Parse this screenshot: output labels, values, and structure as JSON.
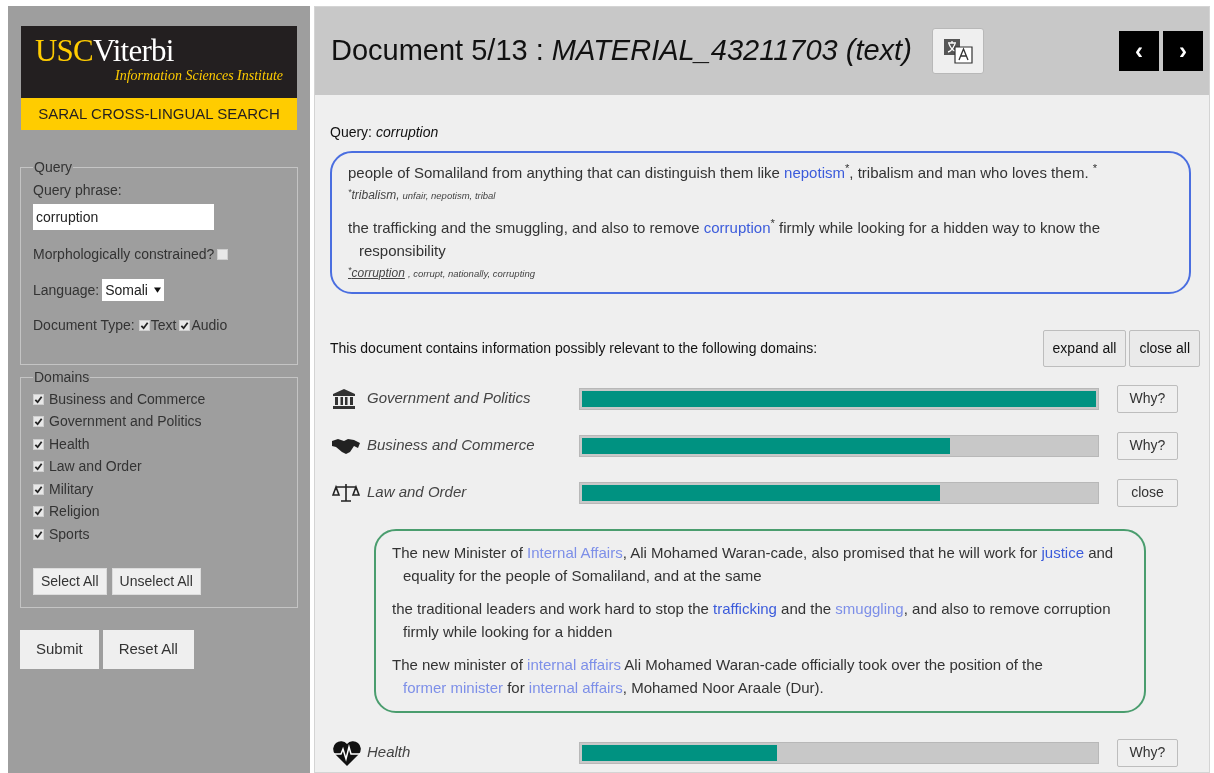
{
  "sidebar": {
    "logo": {
      "brand": "USC",
      "name": "Viterbi",
      "subtitle": "Information Sciences Institute"
    },
    "app_title": "SARAL CROSS-LINGUAL SEARCH",
    "query": {
      "legend": "Query",
      "phrase_label": "Query phrase:",
      "phrase_value": "corruption",
      "morph_label": "Morphologically constrained?",
      "morph_checked": false,
      "language_label": "Language:",
      "language_value": "Somali",
      "doc_type_label": "Document Type:",
      "doc_types": [
        {
          "label": "Text",
          "checked": true
        },
        {
          "label": "Audio",
          "checked": true
        }
      ]
    },
    "domains": {
      "legend": "Domains",
      "items": [
        {
          "label": "Business and Commerce",
          "checked": true
        },
        {
          "label": "Government and Politics",
          "checked": true
        },
        {
          "label": "Health",
          "checked": true
        },
        {
          "label": "Law and Order",
          "checked": true
        },
        {
          "label": "Military",
          "checked": true
        },
        {
          "label": "Religion",
          "checked": true
        },
        {
          "label": "Sports",
          "checked": true
        }
      ],
      "buttons": [
        "Select All",
        "Unselect All"
      ]
    },
    "buttons": [
      "Submit",
      "Reset All"
    ]
  },
  "header": {
    "title": "Document 5/13 :",
    "document": "MATERIAL_43211703 (text)",
    "nav": [
      "‹",
      "›"
    ]
  },
  "query_label": "Query:",
  "query_term": "corruption",
  "query_matches": [
    {
      "segments": [
        {
          "text": "people of Somaliland from anything that can distinguish them like ",
          "kind": "plain"
        },
        {
          "text": "nepotism",
          "kind": "strong"
        },
        {
          "text": "$^{*}$, tribalism and man who loves them. $^{*}$",
          "kind": "plain"
        }
      ],
      "footnote": [
        {
          "text": "$^{*}$tribalism,",
          "primary": true,
          "underlined": false
        },
        {
          "text": "unfair, nepotism, tribal",
          "primary": false,
          "underlined": false
        }
      ]
    },
    {
      "segments": [
        {
          "text": "the trafficking and the smuggling, and also to remove ",
          "kind": "plain"
        },
        {
          "text": "corruption",
          "kind": "strong"
        },
        {
          "text": "$^{*}$ firmly while looking for a hidden way to know the responsibility",
          "kind": "plain"
        }
      ],
      "footnote": [
        {
          "text": "$^{*}$corruption",
          "primary": true,
          "underlined": true
        },
        {
          "text": ", corrupt, nationally, corrupting",
          "primary": false,
          "underlined": false
        }
      ]
    }
  ],
  "domains_intro": "This document contains information possibly relevant to the following domains:",
  "domain_buttons": [
    "expand all",
    "close all"
  ],
  "domains": [
    {
      "kind": "government",
      "label": "Government and Politics",
      "level": 1.0,
      "button": "Why?"
    },
    {
      "kind": "business",
      "label": "Business and Commerce",
      "level": 0.715,
      "button": "Why?"
    },
    {
      "kind": "law",
      "label": "Law and Order",
      "level": 0.697,
      "button": "close",
      "snippets": [
        {
          "segments": [
            {
              "text": "The new Minister of ",
              "kind": "plain"
            },
            {
              "text": "Internal Affairs",
              "kind": "light"
            },
            {
              "text": ", Ali Mohamed Waran-cade, also promised that he will work for ",
              "kind": "plain"
            },
            {
              "text": "justice",
              "kind": "strong"
            },
            {
              "text": " and equality for the people of Somaliland, and at the same",
              "kind": "plain"
            }
          ]
        },
        {
          "segments": [
            {
              "text": "the traditional leaders and work hard to stop the ",
              "kind": "plain"
            },
            {
              "text": "trafficking",
              "kind": "strong"
            },
            {
              "text": " and the ",
              "kind": "plain"
            },
            {
              "text": "smuggling",
              "kind": "light"
            },
            {
              "text": ", and also to remove corruption firmly while looking for a hidden",
              "kind": "plain"
            }
          ]
        },
        {
          "segments": [
            {
              "text": "The new minister of ",
              "kind": "plain"
            },
            {
              "text": "internal affairs",
              "kind": "light"
            },
            {
              "text": " Ali Mohamed Waran-cade officially took over the position of the ",
              "kind": "plain"
            },
            {
              "text": "former minister",
              "kind": "light"
            },
            {
              "text": " for ",
              "kind": "plain"
            },
            {
              "text": "internal affairs",
              "kind": "light"
            },
            {
              "text": ", Mohamed Noor Araale (Dur).",
              "kind": "plain"
            }
          ]
        }
      ]
    },
    {
      "kind": "health",
      "label": "Health",
      "level": 0.38,
      "button": "Why?"
    }
  ]
}
